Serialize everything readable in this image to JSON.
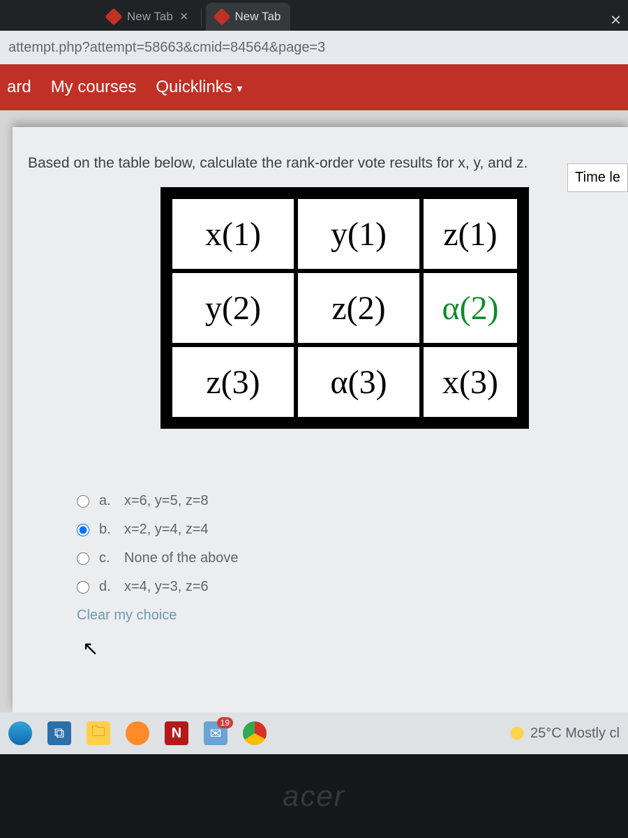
{
  "tabs": {
    "inactive_label": "New Tab",
    "active_label": "New Tab"
  },
  "url": "attempt.php?attempt=58663&cmid=84564&page=3",
  "nav": {
    "item1": "ard",
    "item2": "My courses",
    "item3": "Quicklinks"
  },
  "question": {
    "prompt": "Based on the table below, calculate the rank-order vote results for x, y, and z.",
    "time_label": "Time le",
    "table": {
      "r1c1": "x(1)",
      "r1c2": "y(1)",
      "r1c3": "z(1)",
      "r2c1": "y(2)",
      "r2c2": "z(2)",
      "r2c3": "α(2)",
      "r3c1": "z(3)",
      "r3c2": "α(3)",
      "r3c3": "x(3)"
    },
    "options": {
      "a": {
        "letter": "a.",
        "text": "x=6, y=5, z=8"
      },
      "b": {
        "letter": "b.",
        "text": "x=2, y=4, z=4"
      },
      "c": {
        "letter": "c.",
        "text": "None of the above"
      },
      "d": {
        "letter": "d.",
        "text": "x=4, y=3, z=6"
      }
    },
    "clear": "Clear my choice"
  },
  "taskbar": {
    "mail_badge": "19",
    "weather": "25°C  Mostly cl"
  },
  "bezel": "acer"
}
